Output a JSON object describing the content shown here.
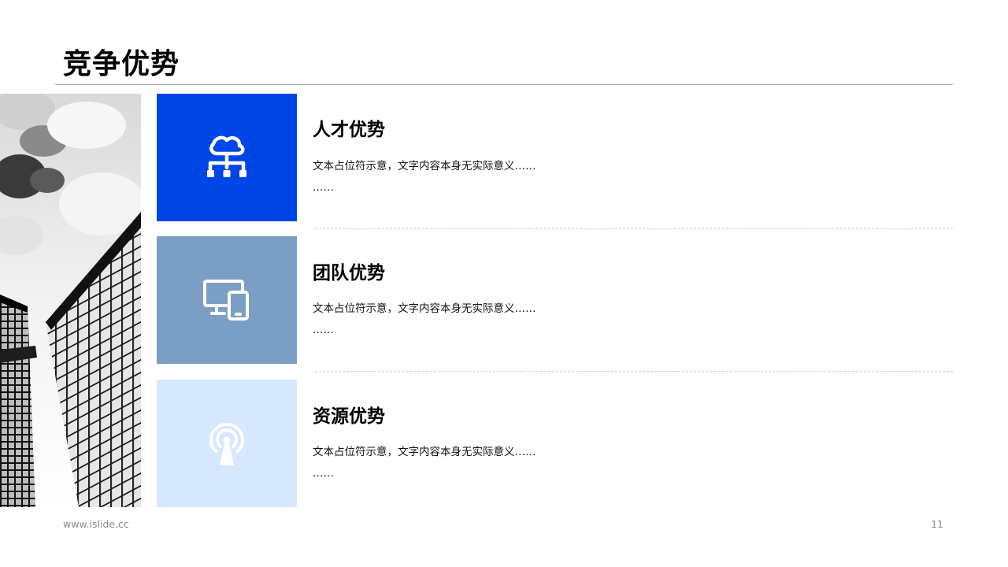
{
  "page": {
    "title": "竞争优势"
  },
  "items": [
    {
      "title": "人才优势",
      "text_line1": "文本占位符示意，文字内容本身无实际意义……",
      "text_line2": "……",
      "icon": "cloud-network-icon",
      "box_color": "#0046e6"
    },
    {
      "title": "团队优势",
      "text_line1": "文本占位符示意，文字内容本身无实际意义……",
      "text_line2": "……",
      "icon": "devices-icon",
      "box_color": "#7b9ec4"
    },
    {
      "title": "资源优势",
      "text_line1": "文本占位符示意，文字内容本身无实际意义……",
      "text_line2": "……",
      "icon": "broadcast-tower-icon",
      "box_color": "#d6e8fe"
    }
  ],
  "footer": {
    "url": "www.islide.cc",
    "page_number": "11"
  }
}
